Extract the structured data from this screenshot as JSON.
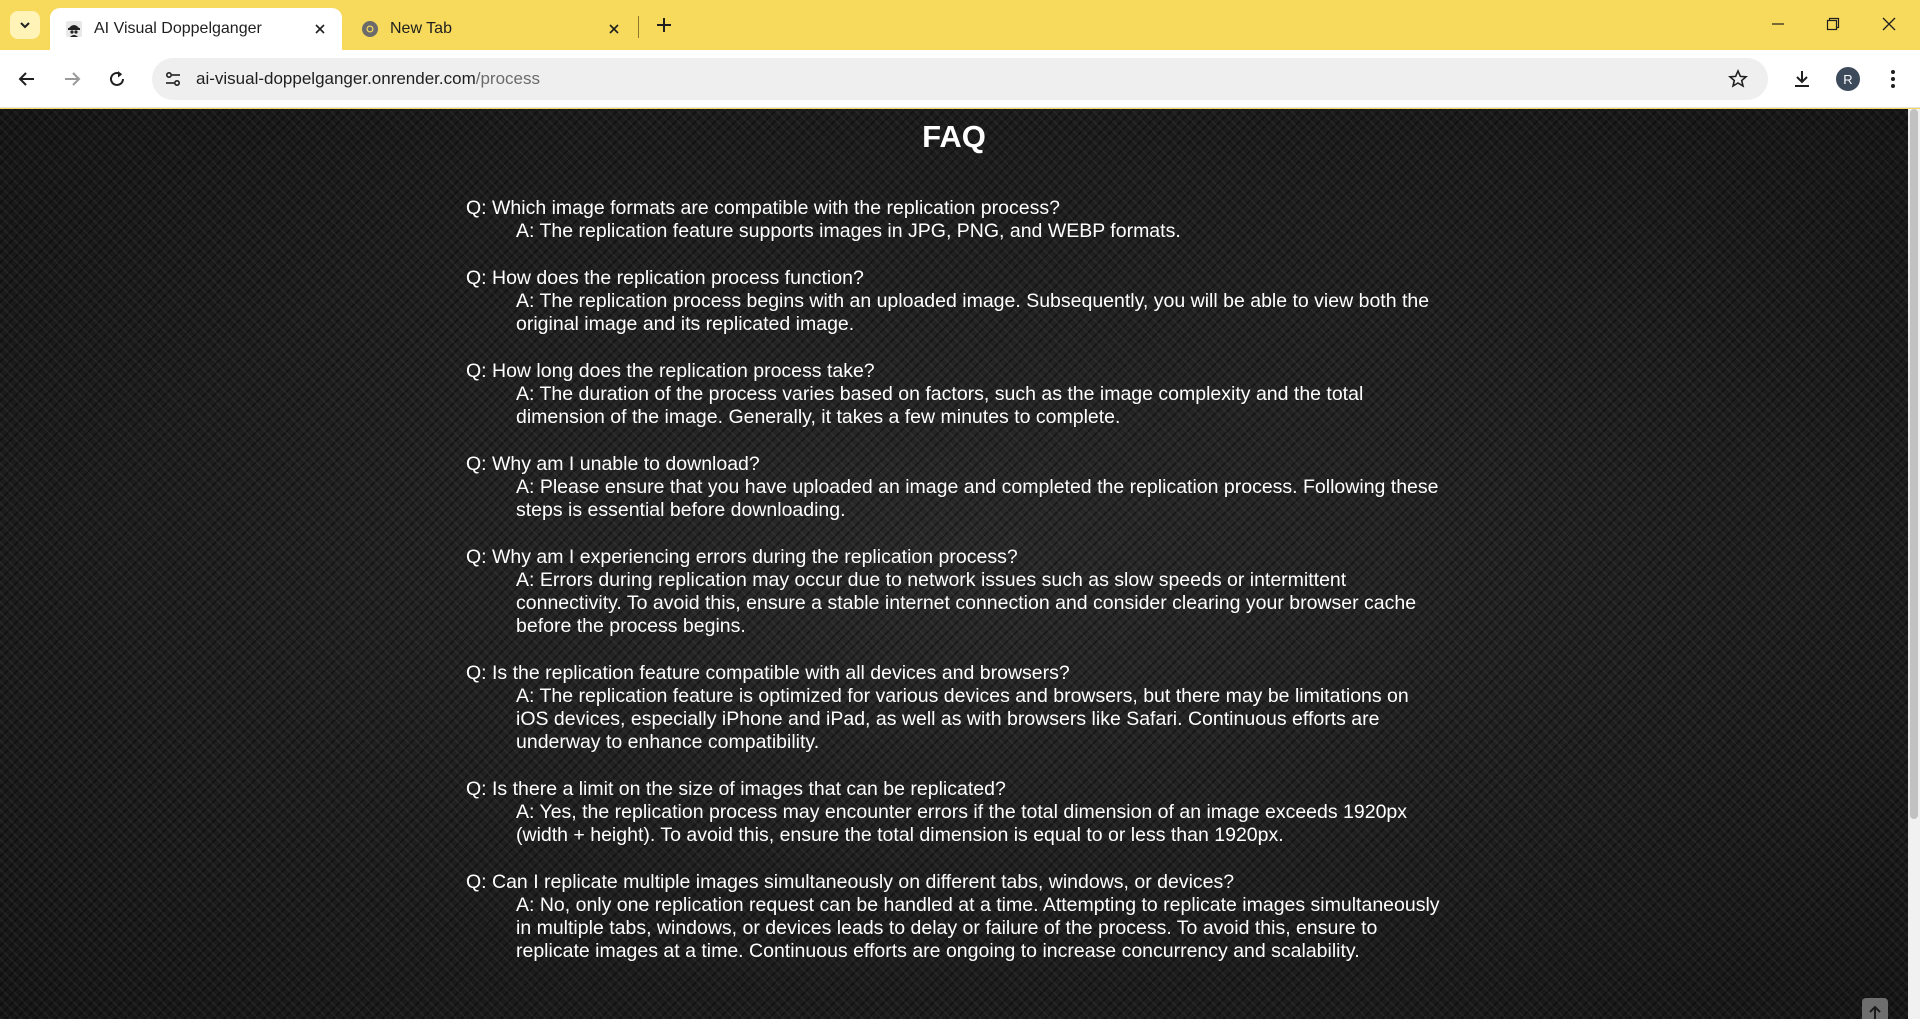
{
  "browser": {
    "tabs": [
      {
        "title": "AI Visual Doppelganger",
        "active": true,
        "icon": "spy-favicon-icon"
      },
      {
        "title": "New Tab",
        "active": false,
        "icon": "chrome-icon"
      }
    ],
    "url_host": "ai-visual-doppelganger.onrender.com",
    "url_path": "/process",
    "profile_initial": "R",
    "colors": {
      "frame": "#f7d95b",
      "page_bg": "#1b1b1b",
      "text": "#ffffff"
    }
  },
  "page": {
    "heading": "FAQ",
    "faqs": [
      {
        "q": "Q: Which image formats are compatible with the replication process?",
        "a": "A: The replication feature supports images in JPG, PNG, and WEBP formats."
      },
      {
        "q": "Q: How does the replication process function?",
        "a": "A: The replication process begins with an uploaded image. Subsequently, you will be able to view both the original image and its replicated image."
      },
      {
        "q": "Q: How long does the replication process take?",
        "a": "A: The duration of the process varies based on factors, such as the image complexity and the total dimension of the image. Generally, it takes a few minutes to complete."
      },
      {
        "q": "Q: Why am I unable to download?",
        "a": "A: Please ensure that you have uploaded an image and completed the replication process. Following these steps is essential before downloading."
      },
      {
        "q": "Q: Why am I experiencing errors during the replication process?",
        "a": "A: Errors during replication may occur due to network issues such as slow speeds or intermittent connectivity. To avoid this, ensure a stable internet connection and consider clearing your browser cache before the process begins."
      },
      {
        "q": "Q: Is the replication feature compatible with all devices and browsers?",
        "a": "A: The replication feature is optimized for various devices and browsers, but there may be limitations on iOS devices, especially iPhone and iPad, as well as with browsers like Safari. Continuous efforts are underway to enhance compatibility."
      },
      {
        "q": "Q: Is there a limit on the size of images that can be replicated?",
        "a": "A: Yes, the replication process may encounter errors if the total dimension of an image exceeds 1920px (width + height). To avoid this, ensure the total dimension is equal to or less than 1920px."
      },
      {
        "q": "Q: Can I replicate multiple images simultaneously on different tabs, windows, or devices?",
        "a": "A: No, only one replication request can be handled at a time. Attempting to replicate images simultaneously in multiple tabs, windows, or devices leads to delay or failure of the process. To avoid this, ensure to replicate images at a time. Continuous efforts are ongoing to increase concurrency and scalability."
      }
    ]
  }
}
